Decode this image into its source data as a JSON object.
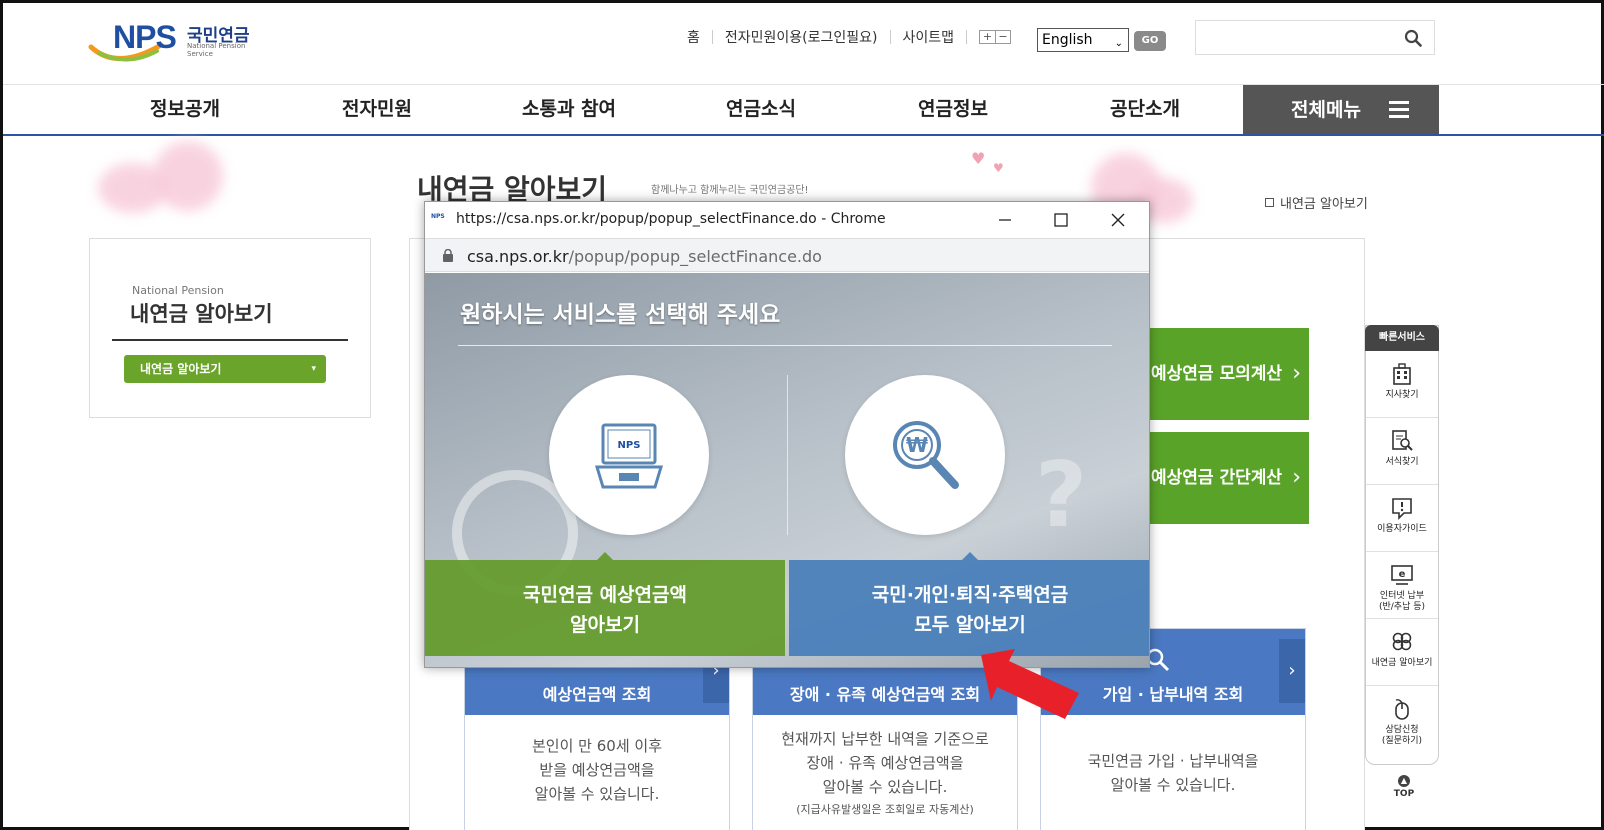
{
  "header": {
    "logo_main": "NPS",
    "logo_ko": "국민연금",
    "logo_en": "National Pension Service",
    "util_links": [
      "홈",
      "전자민원이용(로그인필요)",
      "사이트맵"
    ],
    "zoom_plus": "+",
    "zoom_minus": "−",
    "language": "English",
    "go_label": "GO",
    "search_placeholder": ""
  },
  "nav": {
    "items": [
      "정보공개",
      "전자민원",
      "소통과 참여",
      "연금소식",
      "연금정보",
      "공단소개"
    ],
    "all_menu": "전체메뉴"
  },
  "page": {
    "title": "내연금 알아보기",
    "subtitle": "함께나누고 함께누리는 국민연금공단!",
    "breadcrumb": "내연금 알아보기"
  },
  "lnb": {
    "en": "National Pension",
    "title": "내연금 알아보기",
    "selected": "내연금 알아보기"
  },
  "content": {
    "green_cards": [
      "예상연금 모의계산",
      "예상연금 간단계산"
    ],
    "cards": [
      {
        "title": "예상연금액 조회",
        "desc1": "본인이 만 60세 이후",
        "desc2": "받을 예상연금액을",
        "desc3": "알아볼 수 있습니다.",
        "note": ""
      },
      {
        "title": "장애 · 유족 예상연금액 조회",
        "desc1": "현재까지 납부한 내역을 기준으로",
        "desc2": "장애 · 유족 예상연금액을",
        "desc3": "알아볼 수 있습니다.",
        "note": "(지급사유발생일은 조회일로 자동계산)"
      },
      {
        "title": "가입 · 납부내역 조회",
        "desc1": "국민연금 가입 · 납부내역을",
        "desc2": "알아볼 수 있습니다.",
        "desc3": "",
        "note": ""
      }
    ]
  },
  "quick": {
    "title": "빠른서비스",
    "items": [
      {
        "label1": "지사찾기",
        "label2": ""
      },
      {
        "label1": "서식찾기",
        "label2": ""
      },
      {
        "label1": "이용자가이드",
        "label2": ""
      },
      {
        "label1": "인터넷 납부",
        "label2": "(반/추납 등)"
      },
      {
        "label1": "내연금 알아보기",
        "label2": ""
      },
      {
        "label1": "상담신청",
        "label2": "(질문하기)"
      }
    ],
    "top": "TOP"
  },
  "popup": {
    "favicon": "NPS",
    "window_title": "https://csa.nps.or.kr/popup/popup_selectFinance.do - Chrome",
    "url_host": "csa.nps.or.kr",
    "url_path": "/popup/popup_selectFinance.do",
    "heading": "원하시는 서비스를 선택해 주세요",
    "laptop_label": "NPS",
    "option_left_1": "국민연금 예상연금액",
    "option_left_2": "알아보기",
    "option_right_1": "국민·개인·퇴직·주택연금",
    "option_right_2": "모두 알아보기"
  },
  "colors": {
    "nav_dark": "#555555",
    "nav_blue": "#2d54a5",
    "green": "#5aa329",
    "blue": "#4a78c2",
    "arrow_red": "#e8202a"
  }
}
